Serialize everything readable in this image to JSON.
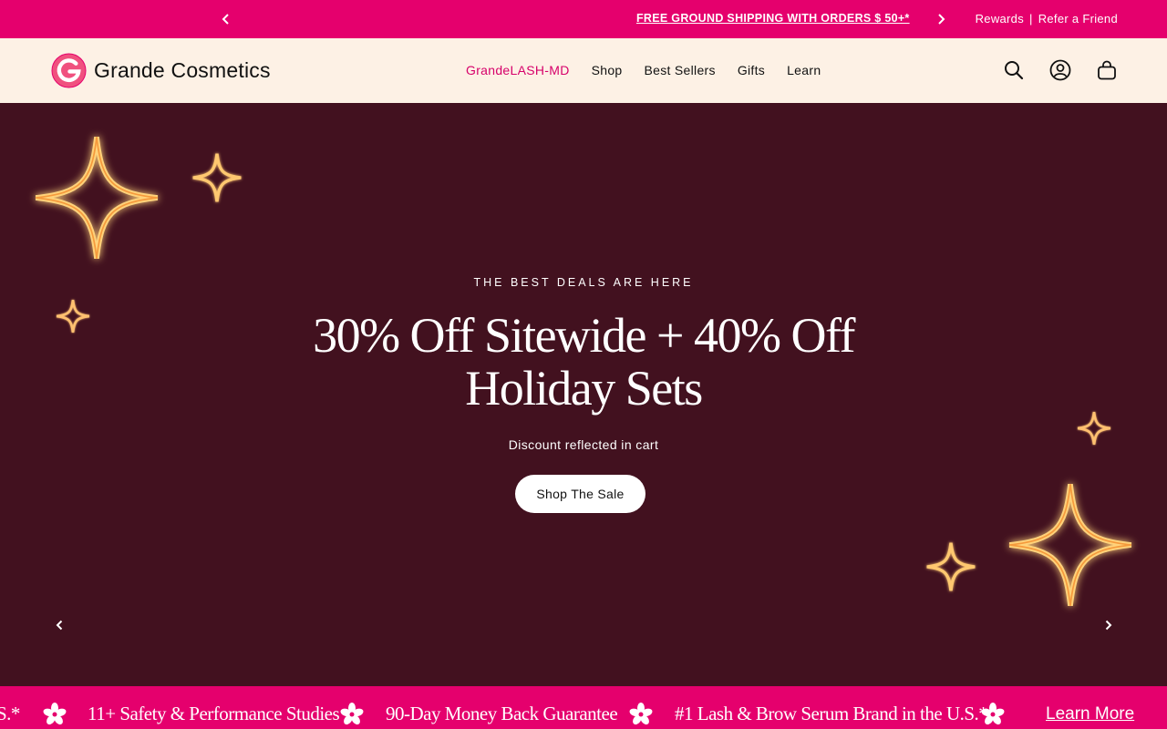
{
  "announcement": {
    "message": "FREE GROUND SHIPPING WITH ORDERS $ 50+*",
    "links": [
      "Rewards",
      "Refer a Friend"
    ],
    "separator": "|"
  },
  "header": {
    "brand": "Grande Cosmetics",
    "nav": [
      "GrandeLASH-MD",
      "Shop",
      "Best Sellers",
      "Gifts",
      "Learn"
    ],
    "icons": [
      "search-icon",
      "account-icon",
      "cart-icon"
    ]
  },
  "hero": {
    "eyebrow": "THE BEST DEALS ARE HERE",
    "headline": "30% Off Sitewide + 40% Off Holiday Sets",
    "subtext": "Discount reflected in cart",
    "cta": "Shop The Sale"
  },
  "marquee": {
    "items": [
      "S.*",
      "11+ Safety & Performance Studies",
      "90-Day Money Back Guarantee",
      "#1 Lash & Brow Serum Brand in the U.S.*"
    ],
    "learn_more": "Learn More"
  },
  "colors": {
    "brand_pink": "#e5006d",
    "header_bg": "#fdf1e5",
    "hero_bg": "#42111f",
    "nav_active": "#d6006a",
    "sparkle_glow": "#ffb347"
  }
}
